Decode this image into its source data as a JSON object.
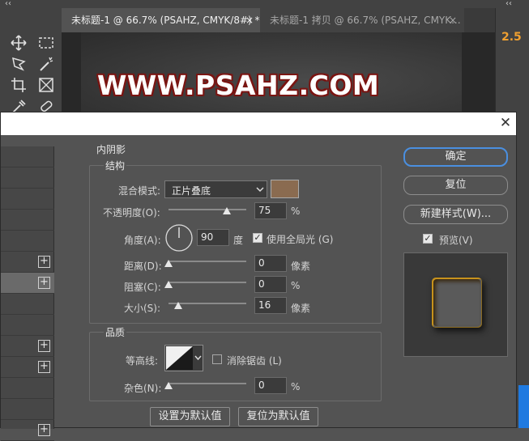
{
  "tabs": [
    {
      "label": "未标题-1 @ 66.7% (PSAHZ, CMYK/8#) *",
      "close": "×"
    },
    {
      "label": "未标题-1 拷贝 @ 66.7% (PSAHZ, CMYK...",
      "close": "×"
    }
  ],
  "canvas_text": "WWW.PSAHZ.COM",
  "right_panel_value": "2.5",
  "collapse_glyph": "‹‹",
  "dialog": {
    "close_glyph": "✕",
    "section_title": "内阴影",
    "structure": {
      "title": "结构",
      "blend_mode_label": "混合模式:",
      "blend_mode_value": "正片叠底",
      "shadow_color": "#8a6b50",
      "opacity_label": "不透明度(O):",
      "opacity_value": "75",
      "opacity_unit": "%",
      "angle_label": "角度(A):",
      "angle_value": "90",
      "angle_unit": "度",
      "global_light_label": "使用全局光 (G)",
      "global_light_checked": true,
      "distance_label": "距离(D):",
      "distance_value": "0",
      "distance_unit": "像素",
      "choke_label": "阻塞(C):",
      "choke_value": "0",
      "choke_unit": "%",
      "size_label": "大小(S):",
      "size_value": "16",
      "size_unit": "像素"
    },
    "quality": {
      "title": "品质",
      "contour_label": "等高线:",
      "anti_alias_label": "消除锯齿 (L)",
      "anti_alias_checked": false,
      "noise_label": "杂色(N):",
      "noise_value": "0",
      "noise_unit": "%"
    },
    "set_default_label": "设置为默认值",
    "reset_default_label": "复位为默认值",
    "ok_label": "确定",
    "reset_label": "复位",
    "new_style_label": "新建样式(W)...",
    "preview_label": "预览(V)",
    "preview_checked": true,
    "plus_glyph": "+"
  }
}
